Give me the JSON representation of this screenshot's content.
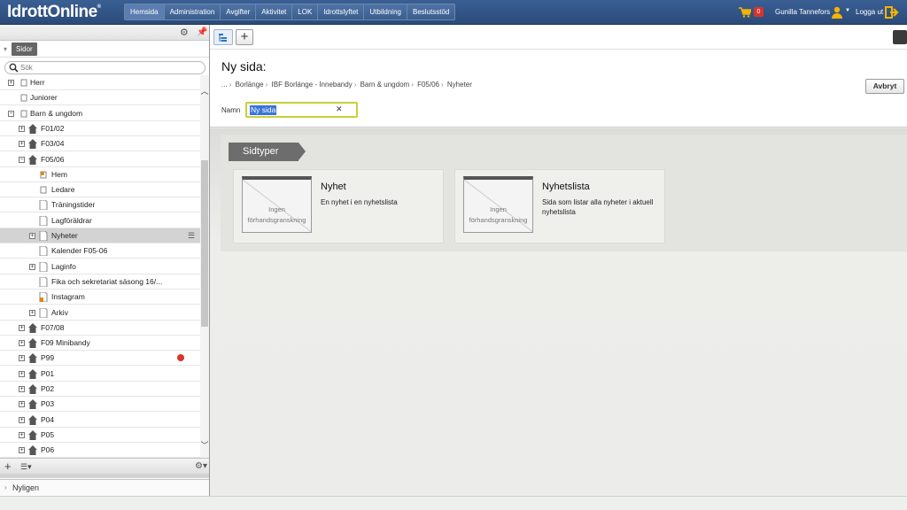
{
  "app": {
    "logo": "IdrottOnline",
    "logo_mark": "®"
  },
  "nav": {
    "items": [
      "Hemsida",
      "Administration",
      "Avgifter",
      "Aktivitet",
      "LOK",
      "Idrottslyftet",
      "Utbildning",
      "Beslutsstöd"
    ],
    "cart_count": "0",
    "user_name": "Gunilla Tannefors",
    "logout_label": "Logga ut"
  },
  "sidebar": {
    "panel_tab": "Sidor",
    "search_placeholder": "Sök",
    "tree": [
      {
        "label": "Herr",
        "level": 1,
        "expander": "+",
        "icon": "page-small-icon"
      },
      {
        "label": "Juniorer",
        "level": 1,
        "expander": "",
        "icon": "page-small-icon"
      },
      {
        "label": "Barn & ungdom",
        "level": 1,
        "expander": "−",
        "icon": "page-small-icon"
      },
      {
        "label": "F01/02",
        "level": 2,
        "expander": "+",
        "icon": "home-icon"
      },
      {
        "label": "F03/04",
        "level": 2,
        "expander": "+",
        "icon": "home-icon"
      },
      {
        "label": "F05/06",
        "level": 2,
        "expander": "−",
        "icon": "home-icon"
      },
      {
        "label": "Hem",
        "level": 3,
        "expander": "",
        "icon": "start-page-icon"
      },
      {
        "label": "Ledare",
        "level": 3,
        "expander": "",
        "icon": "page-small-icon"
      },
      {
        "label": "Träningstider",
        "level": 3,
        "expander": "",
        "icon": "page-icon"
      },
      {
        "label": "Lagföräldrar",
        "level": 3,
        "expander": "",
        "icon": "page-icon"
      },
      {
        "label": "Nyheter",
        "level": 3,
        "expander": "+",
        "icon": "page-icon",
        "selected": true
      },
      {
        "label": "Kalender F05-06",
        "level": 3,
        "expander": "",
        "icon": "page-icon"
      },
      {
        "label": "Laginfo",
        "level": 3,
        "expander": "+",
        "icon": "page-icon"
      },
      {
        "label": "Fika och sekretariat säsong 16/...",
        "level": 3,
        "expander": "",
        "icon": "page-icon"
      },
      {
        "label": "Instagram",
        "level": 3,
        "expander": "",
        "icon": "page-link-icon"
      },
      {
        "label": "Arkiv",
        "level": 3,
        "expander": "+",
        "icon": "page-icon"
      },
      {
        "label": "F07/08",
        "level": 2,
        "expander": "+",
        "icon": "home-icon"
      },
      {
        "label": "F09 Minibandy",
        "level": 2,
        "expander": "+",
        "icon": "home-icon"
      },
      {
        "label": "P99",
        "level": 2,
        "expander": "+",
        "icon": "home-icon",
        "alert": true
      },
      {
        "label": "P01",
        "level": 2,
        "expander": "+",
        "icon": "home-icon"
      },
      {
        "label": "P02",
        "level": 2,
        "expander": "+",
        "icon": "home-icon"
      },
      {
        "label": "P03",
        "level": 2,
        "expander": "+",
        "icon": "home-icon"
      },
      {
        "label": "P04",
        "level": 2,
        "expander": "+",
        "icon": "home-icon"
      },
      {
        "label": "P05",
        "level": 2,
        "expander": "+",
        "icon": "home-icon"
      },
      {
        "label": "P06",
        "level": 2,
        "expander": "+",
        "icon": "home-icon"
      }
    ],
    "recent_label": "Nyligen"
  },
  "form": {
    "title": "Ny sida:",
    "breadcrumb": [
      "...",
      "Borlänge",
      "IBF Borlänge - Innebandy",
      "Barn & ungdom",
      "F05/06",
      "Nyheter"
    ],
    "cancel_label": "Avbryt",
    "name_label": "Namn",
    "name_value": "Ny sida"
  },
  "page_types": {
    "header": "Sidtyper",
    "no_preview_line1": "Ingen",
    "no_preview_line2": "förhandsgranskning",
    "items": [
      {
        "title": "Nyhet",
        "description": "En nyhet i en nyhetslista"
      },
      {
        "title": "Nyhetslista",
        "description": "Sida som listar alla nyheter i aktuell nyhetslista"
      }
    ]
  },
  "colors": {
    "topbar": "#2b4b7a",
    "selection": "#3875d7",
    "name_field_border": "#c9cf3a",
    "alert": "#d9342b"
  }
}
